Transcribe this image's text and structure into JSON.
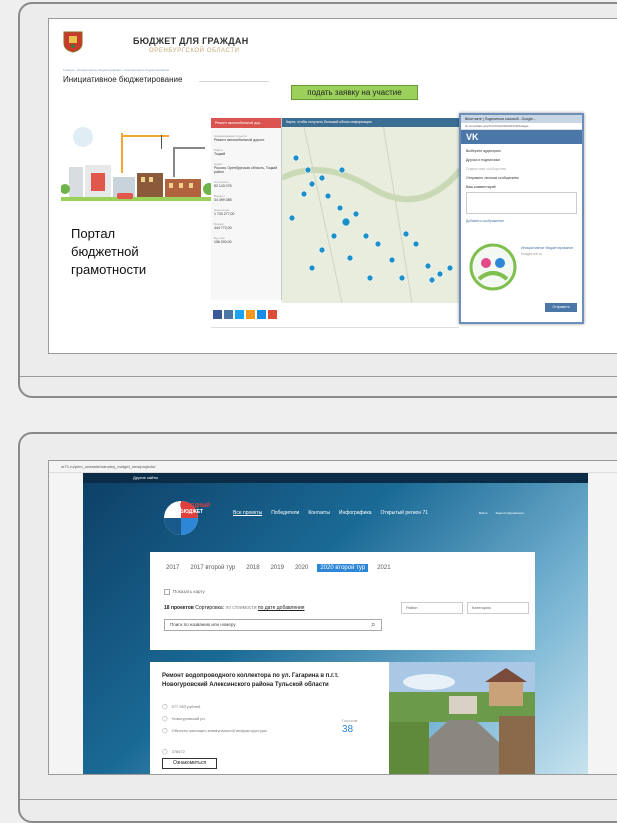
{
  "slide1": {
    "header_title": "БЮДЖЕТ ДЛЯ ГРАЖДАН",
    "header_sub": "ОРЕНБУРГСКОЙ ОБЛАСТИ",
    "breadcrumb": "Главная › Инициативное бюджетирование › Инициативное бюджетирование",
    "page_heading": "Инициативное бюджетирование",
    "apply_button": "подать заявку на участие",
    "portal_line1": "Портал",
    "portal_line2": "бюджетной",
    "portal_line3": "грамотности",
    "side_panel": {
      "header": "Ремонт автомобильной дор...",
      "rows": [
        {
          "k": "Наименование проекта",
          "v": "Ремонт автомобильной дороги"
        },
        {
          "k": "Район",
          "v": "Тоцкий"
        },
        {
          "k": "Адрес",
          "v": "Россия, Оренбургская область, Тоцкий район"
        },
        {
          "k": "Стоимость",
          "v": "52 143 075"
        },
        {
          "k": "Бюджет",
          "v": "34 499 085"
        },
        {
          "k": "Население",
          "v": "1 733 277,00"
        },
        {
          "k": "Бизнес",
          "v": "444 772,00"
        },
        {
          "k": "Ед. изм.",
          "v": "156 000,00"
        }
      ]
    },
    "map_header": "Карта, чтобы получить больший объем информации",
    "vk": {
      "title": "ВКонтакте | Поделиться ссылкой - Google...",
      "url": "vk.com/share.php?url=http%3A%2F%2Fbudget...",
      "brand": "VK",
      "audience_label": "Выберите аудиторию",
      "opt1": "Друзья и подписчики",
      "opt2": "Подписчики сообщества",
      "opt3": "Отправить личным сообщением",
      "comment_label": "Ваш комментарий",
      "attach": "Добавить изображение",
      "link_title": "Инициативное бюджетирование",
      "link_site": "budget.orb.ru",
      "send": "Отправить"
    }
  },
  "slide2": {
    "url": "or71.ru/prim_uchastie/narodny_budget_new/projects/",
    "top_bar": "Другие сайты",
    "logo_l1": "НАРОДНЫЙ",
    "logo_l2": "БЮДЖЕТ",
    "nav": [
      "Все проекты",
      "Победители",
      "Контакты",
      "Инфографика",
      "Открытый регион 71"
    ],
    "nav_small": [
      "Войти",
      "Зарегистрироваться"
    ],
    "years": [
      "2017",
      "2017 второй тур",
      "2018",
      "2019",
      "2020",
      "2020 второй тур",
      "2021"
    ],
    "active_year": "2020 второй тур",
    "show_map": "Показать карту",
    "count_label": "18 проектов",
    "sort_label": "Сортировка:",
    "sort_cost": "по стоимости",
    "sort_date": "по дате добавления",
    "district": "Район",
    "category": "Категория",
    "search_placeholder": "Поиск по названию или номеру",
    "project": {
      "title": "Ремонт водопроводного коллектора по ул. Гагарина в п.г.т. Новогуровский Алексинского района Тульской области",
      "cost": "577 953 рублей",
      "place": "Новогуровский рп.",
      "category": "Объекты жилищно-коммунальной инфраструктуры",
      "number": "378672",
      "votes_label": "Голосов:",
      "votes": "38",
      "cta": "Ознакомиться"
    }
  }
}
